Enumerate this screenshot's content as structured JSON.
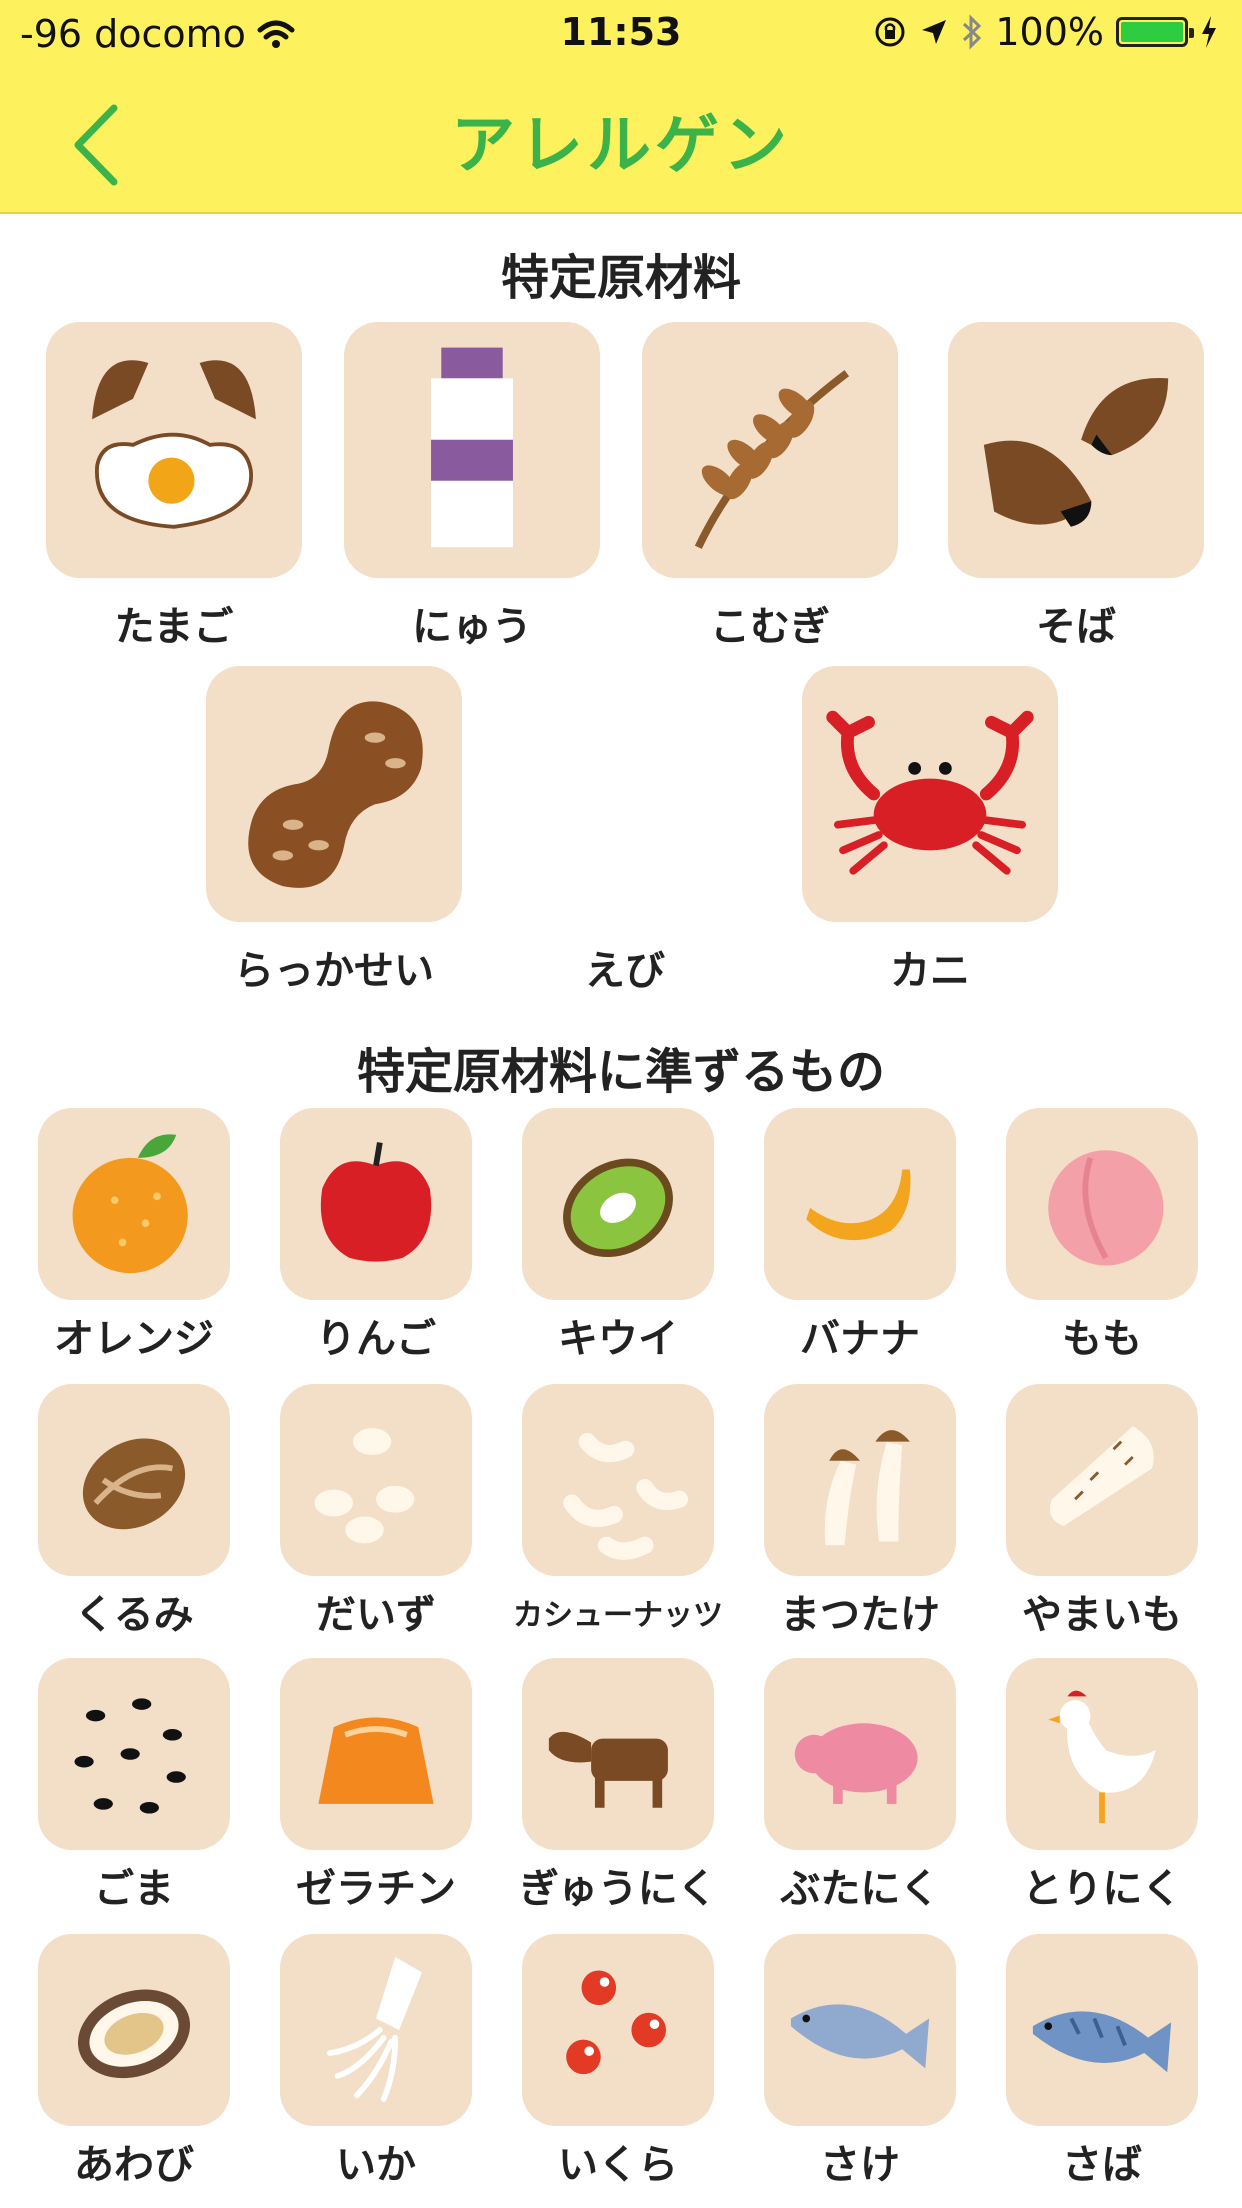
{
  "status_bar": {
    "carrier": "-96 docomo",
    "time": "11:53",
    "battery": "100%",
    "battery_level": 1.0
  },
  "nav": {
    "title": "アレルゲン",
    "back_icon": "chevron-left-icon",
    "title_color": "#3bb34a",
    "bar_color": "#fdf15e"
  },
  "sections": [
    {
      "title": "特定原材料"
    },
    {
      "title": "特定原材料に準ずるもの"
    }
  ],
  "items": {
    "tamago": "たまご",
    "nyuu": "にゅう",
    "komugi": "こむぎ",
    "soba": "そば",
    "rakkasei": "らっかせい",
    "ebi": "えび",
    "kani": "カニ",
    "orange": "オレンジ",
    "ringo": "りんご",
    "kiwi": "キウイ",
    "banana": "バナナ",
    "momo": "もも",
    "kurumi": "くるみ",
    "daizu": "だいず",
    "cashew": "カシューナッツ",
    "matsutake": "まつたけ",
    "yamaimo": "やまいも",
    "goma": "ごま",
    "gelatin": "ゼラチン",
    "gyuniku": "ぎゅうにく",
    "butaniku": "ぶたにく",
    "toriniku": "とりにく",
    "awabi": "あわび",
    "ika": "いか",
    "ikura": "いくら",
    "sake": "さけ",
    "saba": "さば"
  },
  "tile_color": "#f3dec7"
}
